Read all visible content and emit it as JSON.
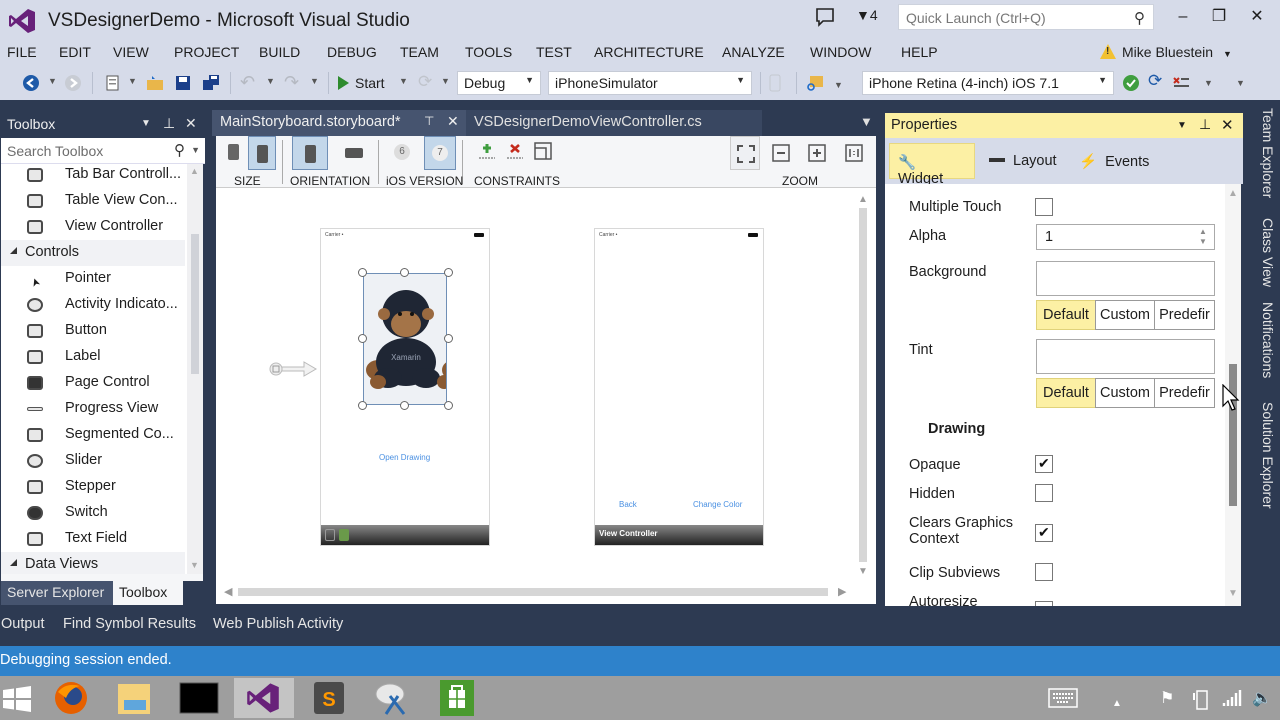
{
  "window": {
    "title": "VSDesignerDemo - Microsoft Visual Studio",
    "notification_count": "4",
    "quick_launch_placeholder": "Quick Launch (Ctrl+Q)",
    "controls": {
      "minimize": "–",
      "restore": "❐",
      "close": "✕"
    }
  },
  "menu": {
    "items": [
      "FILE",
      "EDIT",
      "VIEW",
      "PROJECT",
      "BUILD",
      "DEBUG",
      "TEAM",
      "TOOLS",
      "TEST",
      "ARCHITECTURE",
      "ANALYZE",
      "WINDOW",
      "HELP"
    ],
    "user": "Mike Bluestein"
  },
  "toolbar": {
    "start_label": "Start",
    "configuration": "Debug",
    "platform": "iPhoneSimulator",
    "device": "iPhone Retina (4-inch) iOS 7.1"
  },
  "toolbox": {
    "title": "Toolbox",
    "search_placeholder": "Search Toolbox",
    "items": [
      {
        "label": "Tab Bar Controll...",
        "icon": "tab-bar-controller-icon",
        "category": false
      },
      {
        "label": "Table View Con...",
        "icon": "table-view-controller-icon",
        "category": false
      },
      {
        "label": "View Controller",
        "icon": "view-controller-icon",
        "category": false
      },
      {
        "label": "Controls",
        "icon": "",
        "category": true
      },
      {
        "label": "Pointer",
        "icon": "pointer-icon",
        "category": false
      },
      {
        "label": "Activity Indicato...",
        "icon": "activity-indicator-icon",
        "category": false
      },
      {
        "label": "Button",
        "icon": "button-icon",
        "category": false
      },
      {
        "label": "Label",
        "icon": "label-icon",
        "category": false
      },
      {
        "label": "Page Control",
        "icon": "page-control-icon",
        "category": false
      },
      {
        "label": "Progress View",
        "icon": "progress-view-icon",
        "category": false
      },
      {
        "label": "Segmented Co...",
        "icon": "segmented-control-icon",
        "category": false
      },
      {
        "label": "Slider",
        "icon": "slider-icon",
        "category": false
      },
      {
        "label": "Stepper",
        "icon": "stepper-icon",
        "category": false
      },
      {
        "label": "Switch",
        "icon": "switch-icon",
        "category": false
      },
      {
        "label": "Text Field",
        "icon": "text-field-icon",
        "category": false
      },
      {
        "label": "Data Views",
        "icon": "",
        "category": true
      }
    ],
    "bottom_tabs": [
      "Server Explorer",
      "Toolbox"
    ]
  },
  "documents": {
    "tabs": [
      {
        "label": "MainStoryboard.storyboard*",
        "active": true
      },
      {
        "label": "VSDesignerDemoViewController.cs",
        "active": false
      }
    ]
  },
  "designer_toolbar": {
    "groups": [
      "SIZE",
      "ORIENTATION",
      "iOS VERSION",
      "CONSTRAINTS",
      "ZOOM"
    ],
    "ios_versions": [
      "6",
      "7"
    ]
  },
  "storyboard": {
    "status_carrier": "Carrier •",
    "first_screen": {
      "button": "Open Drawing",
      "image_text": "Xamarin"
    },
    "second_screen": {
      "back_button": "Back",
      "change_color_button": "Change Color",
      "dock_label": "View Controller"
    }
  },
  "properties": {
    "title": "Properties",
    "tabs": [
      "Widget",
      "Layout",
      "Events"
    ],
    "active_tab": "Widget",
    "rows": {
      "multiple_touch": {
        "label": "Multiple Touch",
        "checked": false
      },
      "alpha": {
        "label": "Alpha",
        "value": "1"
      },
      "background": {
        "label": "Background",
        "value": ""
      },
      "tint": {
        "label": "Tint",
        "value": ""
      },
      "section_drawing": "Drawing",
      "opaque": {
        "label": "Opaque",
        "checked": true
      },
      "hidden": {
        "label": "Hidden",
        "checked": false
      },
      "clears_graphics_line1": "Clears Graphics",
      "clears_graphics_line2": "Context",
      "clears_graphics_checked": true,
      "clip_subviews": {
        "label": "Clip Subviews",
        "checked": false
      },
      "autoresize": {
        "label": "Autoresize"
      }
    },
    "color_modes": [
      "Default",
      "Custom",
      "Predefir"
    ],
    "selected_color_mode": "Default"
  },
  "side_tabs": [
    "Team Explorer",
    "Class View",
    "Notifications",
    "Solution Explorer"
  ],
  "bottom_tabs": [
    "Output",
    "Find Symbol Results",
    "Web Publish Activity"
  ],
  "status": {
    "text": "Debugging session ended."
  },
  "colors": {
    "chrome": "#d6dbe9",
    "dark_frame": "#2d3a52",
    "status_blue": "#2e82cb",
    "active_yellow": "#fcf0a4",
    "vs_purple": "#68217a"
  },
  "taskbar": {
    "apps": [
      "windows-start",
      "firefox",
      "file-explorer",
      "command-prompt",
      "visual-studio",
      "sublime-text",
      "snipping-tool",
      "windows-store"
    ],
    "active_app": "visual-studio"
  }
}
